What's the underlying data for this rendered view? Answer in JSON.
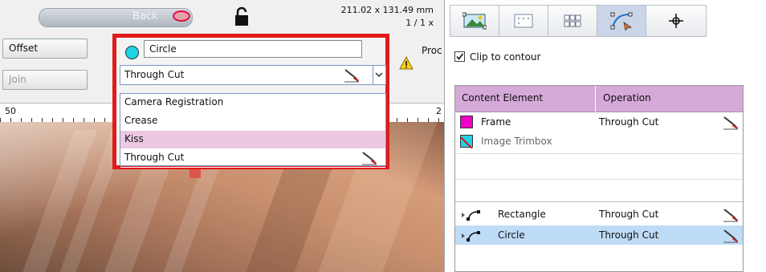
{
  "toolbar": {
    "back_label": "Back",
    "dimensions": "211.02 x 131.49 mm",
    "page_count": "1 / 1 x",
    "offset_label": "Offset",
    "join_label": "Join",
    "proc_label": "Proc"
  },
  "ruler": {
    "start_number": "50",
    "end_number": "2"
  },
  "popup": {
    "name_value": "Circle",
    "swatch_color": "#1ed4e6",
    "selected_operation": "Through Cut",
    "options": [
      "Camera Registration",
      "Crease",
      "Kiss",
      "Through Cut"
    ],
    "highlighted_option": "Kiss"
  },
  "panel": {
    "tabs": [
      {
        "icon": "image-map-icon",
        "active": false
      },
      {
        "icon": "grid-dots-icon",
        "active": false
      },
      {
        "icon": "grid-blocks-icon",
        "active": false
      },
      {
        "icon": "path-node-icon",
        "active": true
      },
      {
        "icon": "registration-mark-icon",
        "active": false
      }
    ],
    "clip_to_contour_label": "Clip to contour",
    "clip_to_contour_checked": true,
    "table": {
      "headers": [
        "Content Element",
        "Operation"
      ],
      "rows": [
        {
          "element": "Frame",
          "operation": "Through Cut",
          "swatch": "#f000c8"
        },
        {
          "element": "Image Trimbox",
          "operation": "",
          "swatch": "#1ed4e6"
        },
        {
          "element": "Rectangle",
          "operation": "Through Cut"
        },
        {
          "element": "Circle",
          "operation": "Through Cut",
          "selected": true
        }
      ]
    }
  }
}
